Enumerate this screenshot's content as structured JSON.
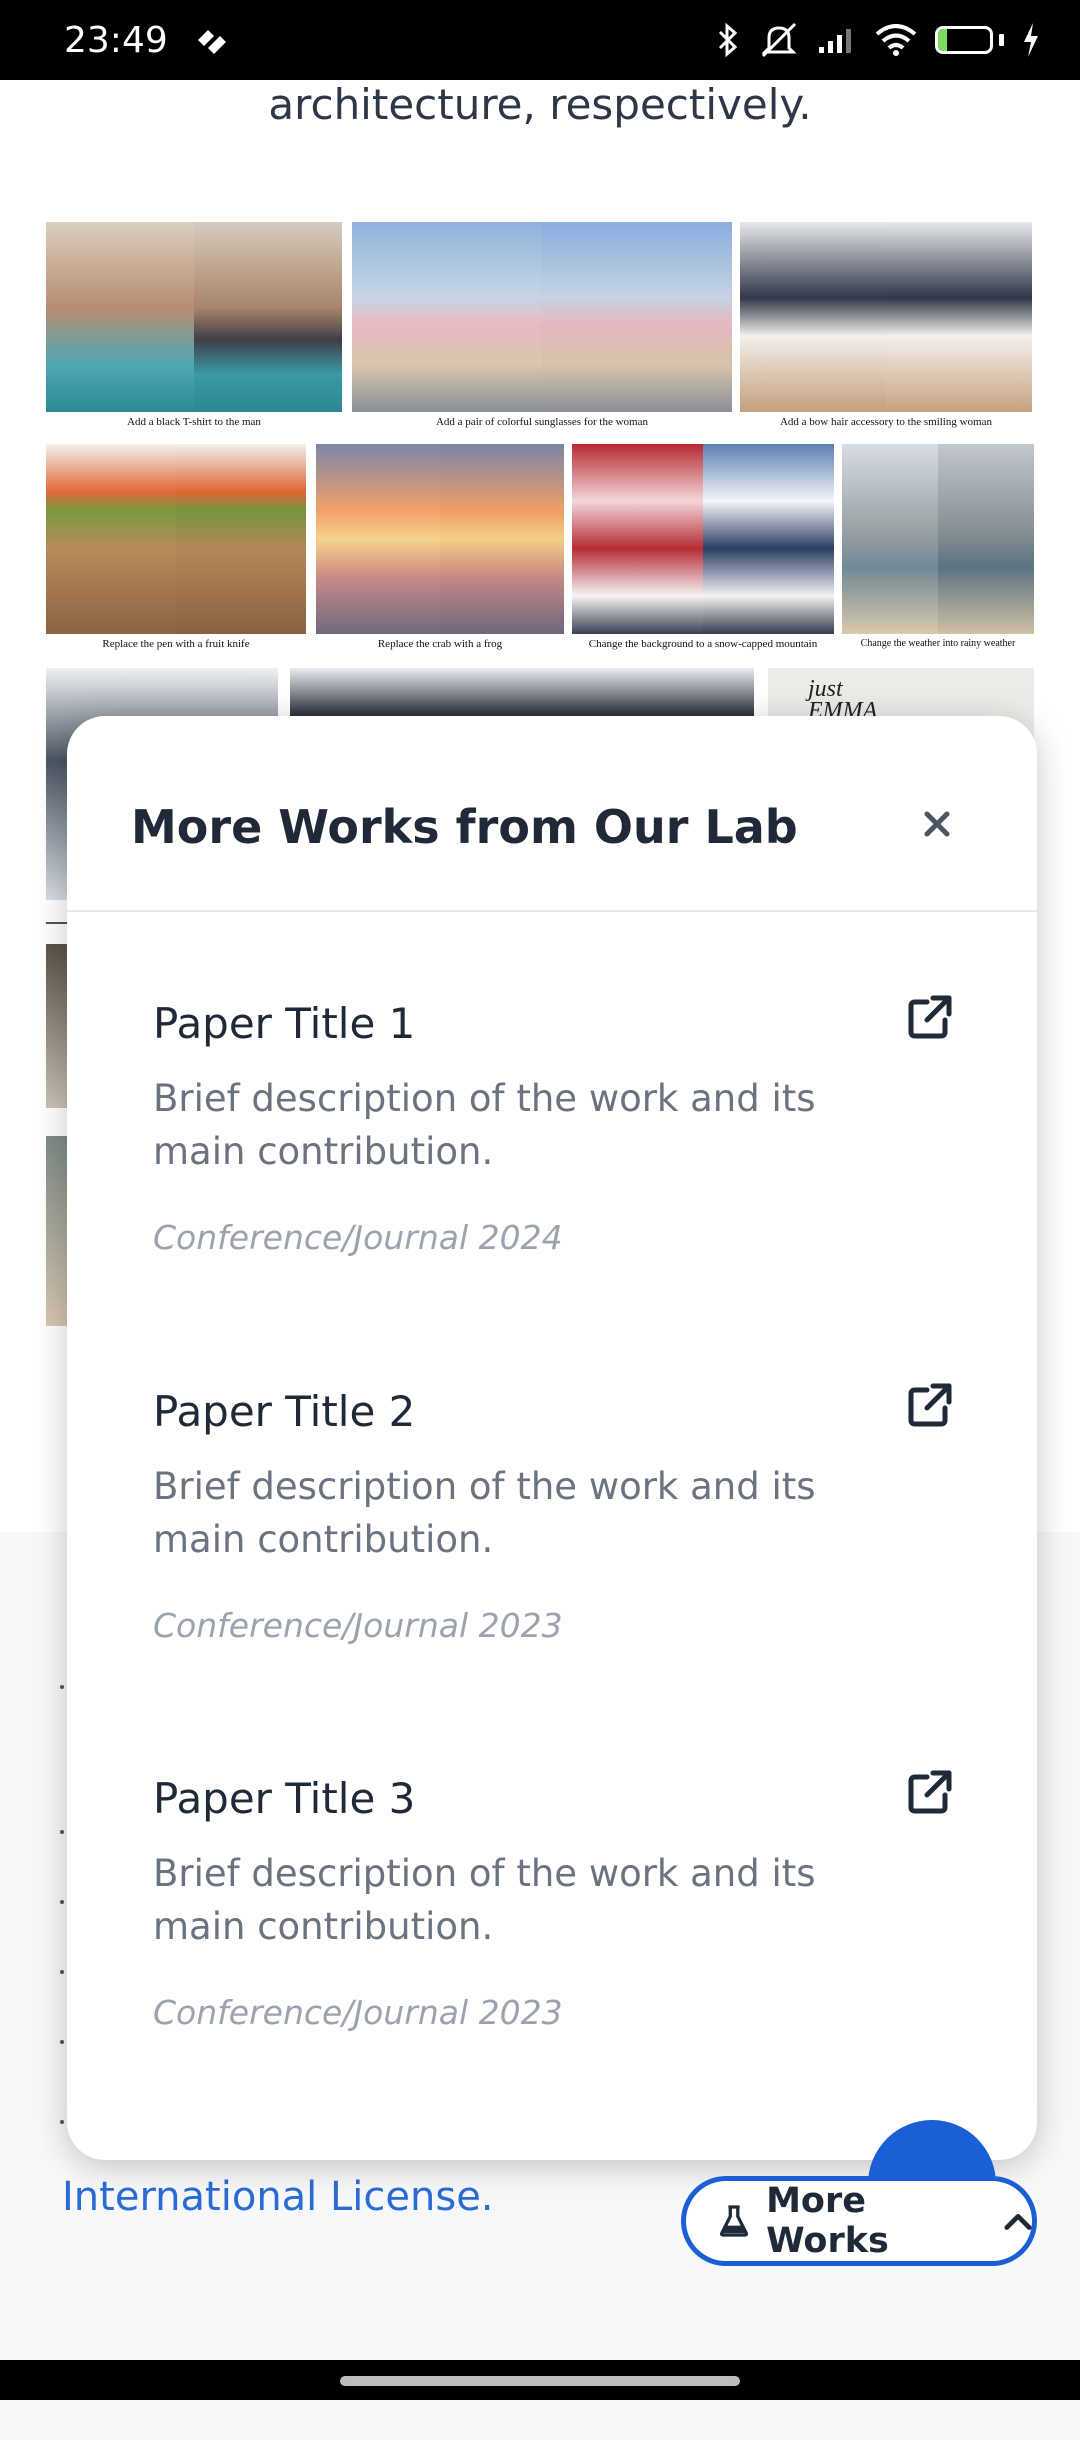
{
  "status_bar": {
    "time": "23:49",
    "battery_level": 17,
    "battery_text": "17",
    "icons": [
      "bluetooth-icon",
      "mute-icon",
      "signal-icon",
      "wifi-icon",
      "battery-icon",
      "charging-icon"
    ]
  },
  "page": {
    "top_text": "architecture, respectively.",
    "gallery_captions": [
      "Add a black T-shirt to the man",
      "Add a pair of colorful sunglasses for the woman",
      "Add a bow hair accessory to the smiling woman",
      "Replace the pen with a fruit knife",
      "Replace the crab with a frog",
      "Change the background to a snow-capped mountain",
      "Change the weather into rainy weather"
    ],
    "partial_image_text": "just\nEMMA",
    "footer_link_text": "International License."
  },
  "modal": {
    "title": "More Works from Our Lab",
    "close_label": "×",
    "works": [
      {
        "title": "Paper Title 1",
        "description": "Brief description of the work and its main contribution.",
        "venue": "Conference/Journal 2024"
      },
      {
        "title": "Paper Title 2",
        "description": "Brief description of the work and its main contribution.",
        "venue": "Conference/Journal 2023"
      },
      {
        "title": "Paper Title 3",
        "description": "Brief description of the work and its main contribution.",
        "venue": "Conference/Journal 2023"
      }
    ]
  },
  "floating_button": {
    "label": "More Works",
    "icon": "flask-icon",
    "chevron": "chevron-up-icon"
  },
  "colors": {
    "accent": "#1a5fd6",
    "link": "#2b6cd4",
    "title": "#1f2937",
    "muted": "#6b7280",
    "venue": "#9ca3af"
  }
}
